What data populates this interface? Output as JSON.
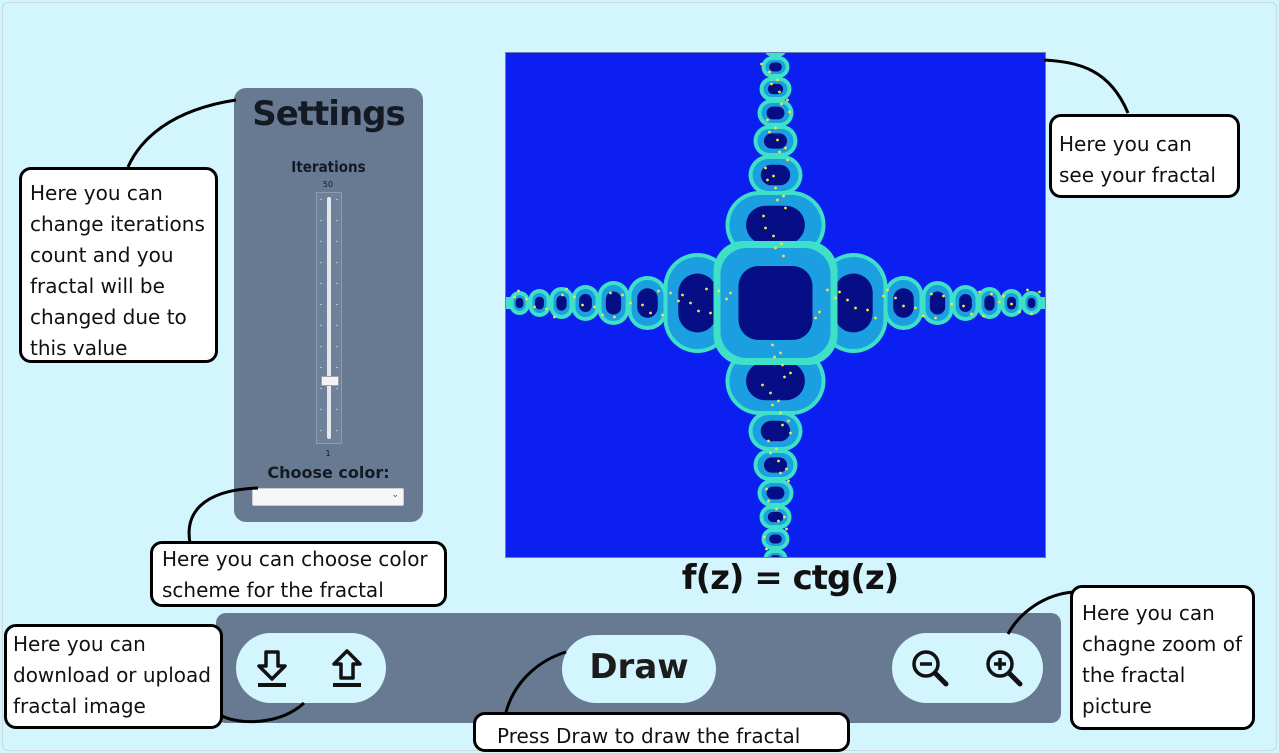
{
  "settings": {
    "title": "Settings",
    "iterations_label": "Iterations",
    "slider_max": "50",
    "slider_min": "1",
    "slider_value_fraction": 0.22,
    "color_label": "Choose color:",
    "color_selected": ""
  },
  "fractal": {
    "formula": "f(z) = ctg(z)",
    "colors": {
      "background": "#0b20f0",
      "core": "#050e85",
      "halo": "#1b9fe0",
      "edge": "#3ee0c8",
      "speckle": "#f2e24a"
    }
  },
  "toolbar": {
    "draw_label": "Draw",
    "icons": {
      "download": "download-icon",
      "upload": "upload-icon",
      "zoom_out": "zoom-out-icon",
      "zoom_in": "zoom-in-icon"
    }
  },
  "callouts": {
    "iterations": "Here you can\nchange iterations\ncount and you\nfractal will be\nchanged due to\nthis value",
    "fractal_view": "Here you can\nsee your fractal",
    "color_scheme": "Here you can choose color\nscheme for the fractal",
    "download_upload": "Here you can\ndownload or upload\nfractal image",
    "draw": "Press Draw to draw the fractal",
    "zoom": "Here you can\nchagne zoom of\nthe fractal\npicture"
  },
  "colors": {
    "page_background": "#d3f5fd",
    "panel": "#687a91"
  }
}
